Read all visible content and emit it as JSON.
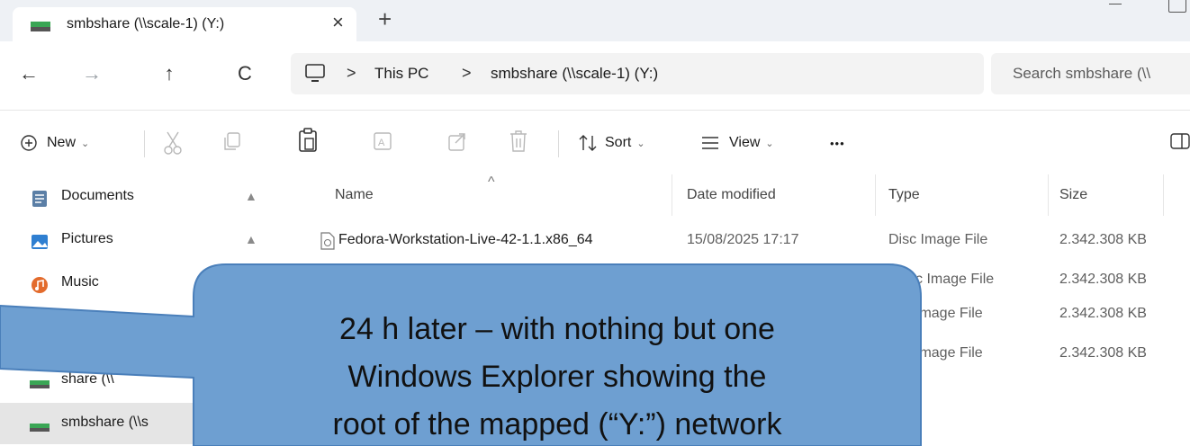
{
  "tab": {
    "title": "smbshare (\\\\scale-1) (Y:)",
    "close_glyph": "×",
    "new_tab_glyph": "+",
    "drive_icon": "network-drive-icon"
  },
  "nav": {
    "back_glyph": "←",
    "forward_glyph": "→",
    "up_glyph": "↑",
    "refresh_glyph": "C",
    "breadcrumb": [
      "This PC",
      "smbshare (\\\\scale-1) (Y:)"
    ],
    "separator_glyph": ">",
    "search_placeholder": "Search smbshare (\\\\"
  },
  "toolbar": {
    "new_label": "New",
    "sort_label": "Sort",
    "view_label": "View",
    "more_glyph": "•••",
    "chevron_glyph": "⌄"
  },
  "sidebar": {
    "items": [
      {
        "label": "Documents",
        "icon": "documents-icon",
        "pinned": true
      },
      {
        "label": "Pictures",
        "icon": "pictures-icon",
        "pinned": true
      },
      {
        "label": "Music",
        "icon": "music-icon",
        "pinned": false
      },
      {
        "label": "share (\\\\",
        "icon": "network-drive-icon",
        "pinned": false
      },
      {
        "label": "smbshare (\\\\s",
        "icon": "network-drive-icon",
        "pinned": false,
        "selected": true
      }
    ],
    "pin_glyph": "📌"
  },
  "columns": {
    "name": "Name",
    "date": "Date modified",
    "type": "Type",
    "size": "Size",
    "sort_caret": "^"
  },
  "files": [
    {
      "name": "Fedora-Workstation-Live-42-1.1.x86_64",
      "date": "15/08/2025 17:17",
      "type": "Disc Image File",
      "size": "2.342.308 KB"
    },
    {
      "name": "",
      "date": "",
      "type": "sc Image File",
      "size": "2.342.308 KB"
    },
    {
      "name": "",
      "date": "",
      "type": "Image File",
      "size": "2.342.308 KB"
    },
    {
      "name": "",
      "date": "",
      "type": "Image File",
      "size": "2.342.308 KB"
    }
  ],
  "callout": {
    "lines": [
      "24 h later – with nothing but one",
      "Windows Explorer showing the",
      "root of the mapped (“Y:”) network"
    ],
    "fill": "#6e9fd1",
    "stroke": "#4a7fba"
  }
}
